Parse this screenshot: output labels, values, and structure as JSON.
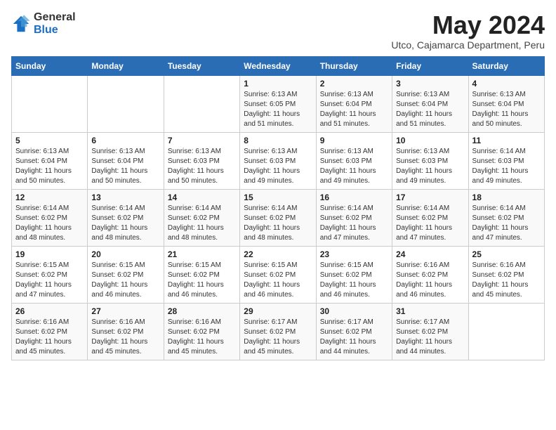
{
  "logo": {
    "general": "General",
    "blue": "Blue"
  },
  "title": {
    "month": "May 2024",
    "location": "Utco, Cajamarca Department, Peru"
  },
  "weekdays": [
    "Sunday",
    "Monday",
    "Tuesday",
    "Wednesday",
    "Thursday",
    "Friday",
    "Saturday"
  ],
  "weeks": [
    [
      {
        "day": "",
        "sunrise": "",
        "sunset": "",
        "daylight": ""
      },
      {
        "day": "",
        "sunrise": "",
        "sunset": "",
        "daylight": ""
      },
      {
        "day": "",
        "sunrise": "",
        "sunset": "",
        "daylight": ""
      },
      {
        "day": "1",
        "sunrise": "Sunrise: 6:13 AM",
        "sunset": "Sunset: 6:05 PM",
        "daylight": "Daylight: 11 hours and 51 minutes."
      },
      {
        "day": "2",
        "sunrise": "Sunrise: 6:13 AM",
        "sunset": "Sunset: 6:04 PM",
        "daylight": "Daylight: 11 hours and 51 minutes."
      },
      {
        "day": "3",
        "sunrise": "Sunrise: 6:13 AM",
        "sunset": "Sunset: 6:04 PM",
        "daylight": "Daylight: 11 hours and 51 minutes."
      },
      {
        "day": "4",
        "sunrise": "Sunrise: 6:13 AM",
        "sunset": "Sunset: 6:04 PM",
        "daylight": "Daylight: 11 hours and 50 minutes."
      }
    ],
    [
      {
        "day": "5",
        "sunrise": "Sunrise: 6:13 AM",
        "sunset": "Sunset: 6:04 PM",
        "daylight": "Daylight: 11 hours and 50 minutes."
      },
      {
        "day": "6",
        "sunrise": "Sunrise: 6:13 AM",
        "sunset": "Sunset: 6:04 PM",
        "daylight": "Daylight: 11 hours and 50 minutes."
      },
      {
        "day": "7",
        "sunrise": "Sunrise: 6:13 AM",
        "sunset": "Sunset: 6:03 PM",
        "daylight": "Daylight: 11 hours and 50 minutes."
      },
      {
        "day": "8",
        "sunrise": "Sunrise: 6:13 AM",
        "sunset": "Sunset: 6:03 PM",
        "daylight": "Daylight: 11 hours and 49 minutes."
      },
      {
        "day": "9",
        "sunrise": "Sunrise: 6:13 AM",
        "sunset": "Sunset: 6:03 PM",
        "daylight": "Daylight: 11 hours and 49 minutes."
      },
      {
        "day": "10",
        "sunrise": "Sunrise: 6:13 AM",
        "sunset": "Sunset: 6:03 PM",
        "daylight": "Daylight: 11 hours and 49 minutes."
      },
      {
        "day": "11",
        "sunrise": "Sunrise: 6:14 AM",
        "sunset": "Sunset: 6:03 PM",
        "daylight": "Daylight: 11 hours and 49 minutes."
      }
    ],
    [
      {
        "day": "12",
        "sunrise": "Sunrise: 6:14 AM",
        "sunset": "Sunset: 6:02 PM",
        "daylight": "Daylight: 11 hours and 48 minutes."
      },
      {
        "day": "13",
        "sunrise": "Sunrise: 6:14 AM",
        "sunset": "Sunset: 6:02 PM",
        "daylight": "Daylight: 11 hours and 48 minutes."
      },
      {
        "day": "14",
        "sunrise": "Sunrise: 6:14 AM",
        "sunset": "Sunset: 6:02 PM",
        "daylight": "Daylight: 11 hours and 48 minutes."
      },
      {
        "day": "15",
        "sunrise": "Sunrise: 6:14 AM",
        "sunset": "Sunset: 6:02 PM",
        "daylight": "Daylight: 11 hours and 48 minutes."
      },
      {
        "day": "16",
        "sunrise": "Sunrise: 6:14 AM",
        "sunset": "Sunset: 6:02 PM",
        "daylight": "Daylight: 11 hours and 47 minutes."
      },
      {
        "day": "17",
        "sunrise": "Sunrise: 6:14 AM",
        "sunset": "Sunset: 6:02 PM",
        "daylight": "Daylight: 11 hours and 47 minutes."
      },
      {
        "day": "18",
        "sunrise": "Sunrise: 6:14 AM",
        "sunset": "Sunset: 6:02 PM",
        "daylight": "Daylight: 11 hours and 47 minutes."
      }
    ],
    [
      {
        "day": "19",
        "sunrise": "Sunrise: 6:15 AM",
        "sunset": "Sunset: 6:02 PM",
        "daylight": "Daylight: 11 hours and 47 minutes."
      },
      {
        "day": "20",
        "sunrise": "Sunrise: 6:15 AM",
        "sunset": "Sunset: 6:02 PM",
        "daylight": "Daylight: 11 hours and 46 minutes."
      },
      {
        "day": "21",
        "sunrise": "Sunrise: 6:15 AM",
        "sunset": "Sunset: 6:02 PM",
        "daylight": "Daylight: 11 hours and 46 minutes."
      },
      {
        "day": "22",
        "sunrise": "Sunrise: 6:15 AM",
        "sunset": "Sunset: 6:02 PM",
        "daylight": "Daylight: 11 hours and 46 minutes."
      },
      {
        "day": "23",
        "sunrise": "Sunrise: 6:15 AM",
        "sunset": "Sunset: 6:02 PM",
        "daylight": "Daylight: 11 hours and 46 minutes."
      },
      {
        "day": "24",
        "sunrise": "Sunrise: 6:16 AM",
        "sunset": "Sunset: 6:02 PM",
        "daylight": "Daylight: 11 hours and 46 minutes."
      },
      {
        "day": "25",
        "sunrise": "Sunrise: 6:16 AM",
        "sunset": "Sunset: 6:02 PM",
        "daylight": "Daylight: 11 hours and 45 minutes."
      }
    ],
    [
      {
        "day": "26",
        "sunrise": "Sunrise: 6:16 AM",
        "sunset": "Sunset: 6:02 PM",
        "daylight": "Daylight: 11 hours and 45 minutes."
      },
      {
        "day": "27",
        "sunrise": "Sunrise: 6:16 AM",
        "sunset": "Sunset: 6:02 PM",
        "daylight": "Daylight: 11 hours and 45 minutes."
      },
      {
        "day": "28",
        "sunrise": "Sunrise: 6:16 AM",
        "sunset": "Sunset: 6:02 PM",
        "daylight": "Daylight: 11 hours and 45 minutes."
      },
      {
        "day": "29",
        "sunrise": "Sunrise: 6:17 AM",
        "sunset": "Sunset: 6:02 PM",
        "daylight": "Daylight: 11 hours and 45 minutes."
      },
      {
        "day": "30",
        "sunrise": "Sunrise: 6:17 AM",
        "sunset": "Sunset: 6:02 PM",
        "daylight": "Daylight: 11 hours and 44 minutes."
      },
      {
        "day": "31",
        "sunrise": "Sunrise: 6:17 AM",
        "sunset": "Sunset: 6:02 PM",
        "daylight": "Daylight: 11 hours and 44 minutes."
      },
      {
        "day": "",
        "sunrise": "",
        "sunset": "",
        "daylight": ""
      }
    ]
  ]
}
